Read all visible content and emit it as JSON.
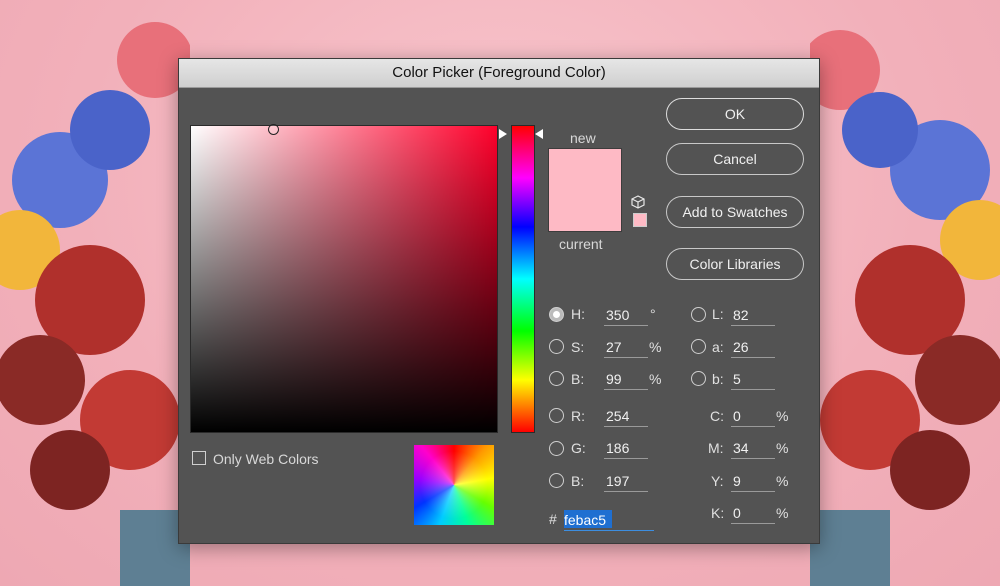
{
  "dialog": {
    "title": "Color Picker (Foreground Color)"
  },
  "swatch": {
    "new_label": "new",
    "current_label": "current",
    "color": "#febac5"
  },
  "buttons": {
    "ok": "OK",
    "cancel": "Cancel",
    "add_to_swatches": "Add to Swatches",
    "color_libraries": "Color Libraries"
  },
  "hsb": {
    "h": {
      "label": "H:",
      "value": "350",
      "unit": "°"
    },
    "s": {
      "label": "S:",
      "value": "27",
      "unit": "%"
    },
    "b": {
      "label": "B:",
      "value": "99",
      "unit": "%"
    }
  },
  "rgb": {
    "r": {
      "label": "R:",
      "value": "254"
    },
    "g": {
      "label": "G:",
      "value": "186"
    },
    "b": {
      "label": "B:",
      "value": "197"
    }
  },
  "lab": {
    "l": {
      "label": "L:",
      "value": "82"
    },
    "a": {
      "label": "a:",
      "value": "26"
    },
    "b": {
      "label": "b:",
      "value": "5"
    }
  },
  "cmyk": {
    "c": {
      "label": "C:",
      "value": "0",
      "unit": "%"
    },
    "m": {
      "label": "M:",
      "value": "34",
      "unit": "%"
    },
    "y": {
      "label": "Y:",
      "value": "9",
      "unit": "%"
    },
    "k": {
      "label": "K:",
      "value": "0",
      "unit": "%"
    }
  },
  "hex": {
    "prefix": "#",
    "value": "febac5"
  },
  "only_web_colors": {
    "label": "Only Web Colors",
    "checked": false
  },
  "selected_mode": "H",
  "icons": {
    "gamut": "cube-icon"
  }
}
